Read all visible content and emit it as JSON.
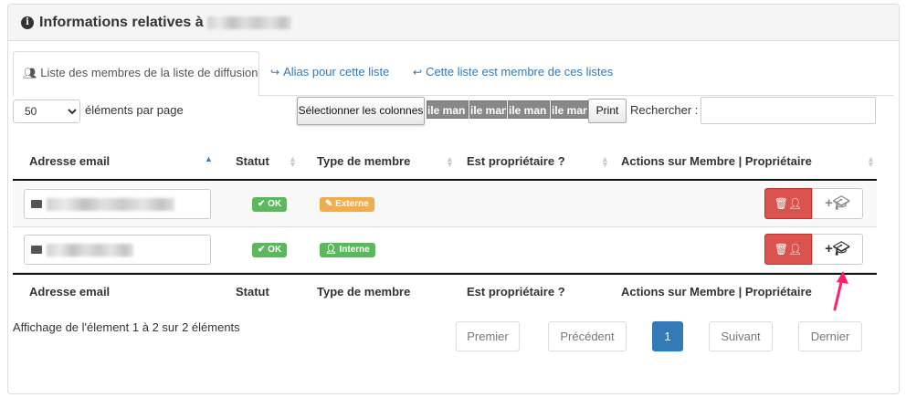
{
  "panel": {
    "title": "Informations relatives à"
  },
  "tabs": [
    {
      "label": "Liste des membres de la liste de diffusion",
      "icon": "users-icon"
    },
    {
      "label": "Alias pour cette liste",
      "icon": "share-icon"
    },
    {
      "label": "Cette liste est membre de ces listes",
      "icon": "reply-icon"
    }
  ],
  "controls": {
    "length_value": "50",
    "length_label": "éléments par page",
    "columns_button": "Sélectionner les colonnes",
    "mail_buttons": [
      "ile man",
      "ile man",
      "ile man",
      "ile man"
    ],
    "print_button": "Print",
    "search_label": "Rechercher :",
    "search_value": ""
  },
  "table": {
    "headers": [
      "Adresse email",
      "Statut",
      "Type de membre",
      "Est propriétaire ?",
      "Actions sur Membre | Propriétaire"
    ],
    "rows": [
      {
        "status": "OK",
        "type": "Externe"
      },
      {
        "status": "OK",
        "type": "Interne"
      }
    ]
  },
  "footer": {
    "info": "Affichage de l'élement 1 à 2 sur 2 éléments",
    "pagination": {
      "first": "Premier",
      "prev": "Précédent",
      "current": "1",
      "next": "Suivant",
      "last": "Dernier"
    }
  },
  "colors": {
    "accent": "#337ab7",
    "danger": "#d9534f",
    "success": "#5cb85c",
    "warning": "#f0ad4e",
    "annotation": "#ff1f6b"
  }
}
